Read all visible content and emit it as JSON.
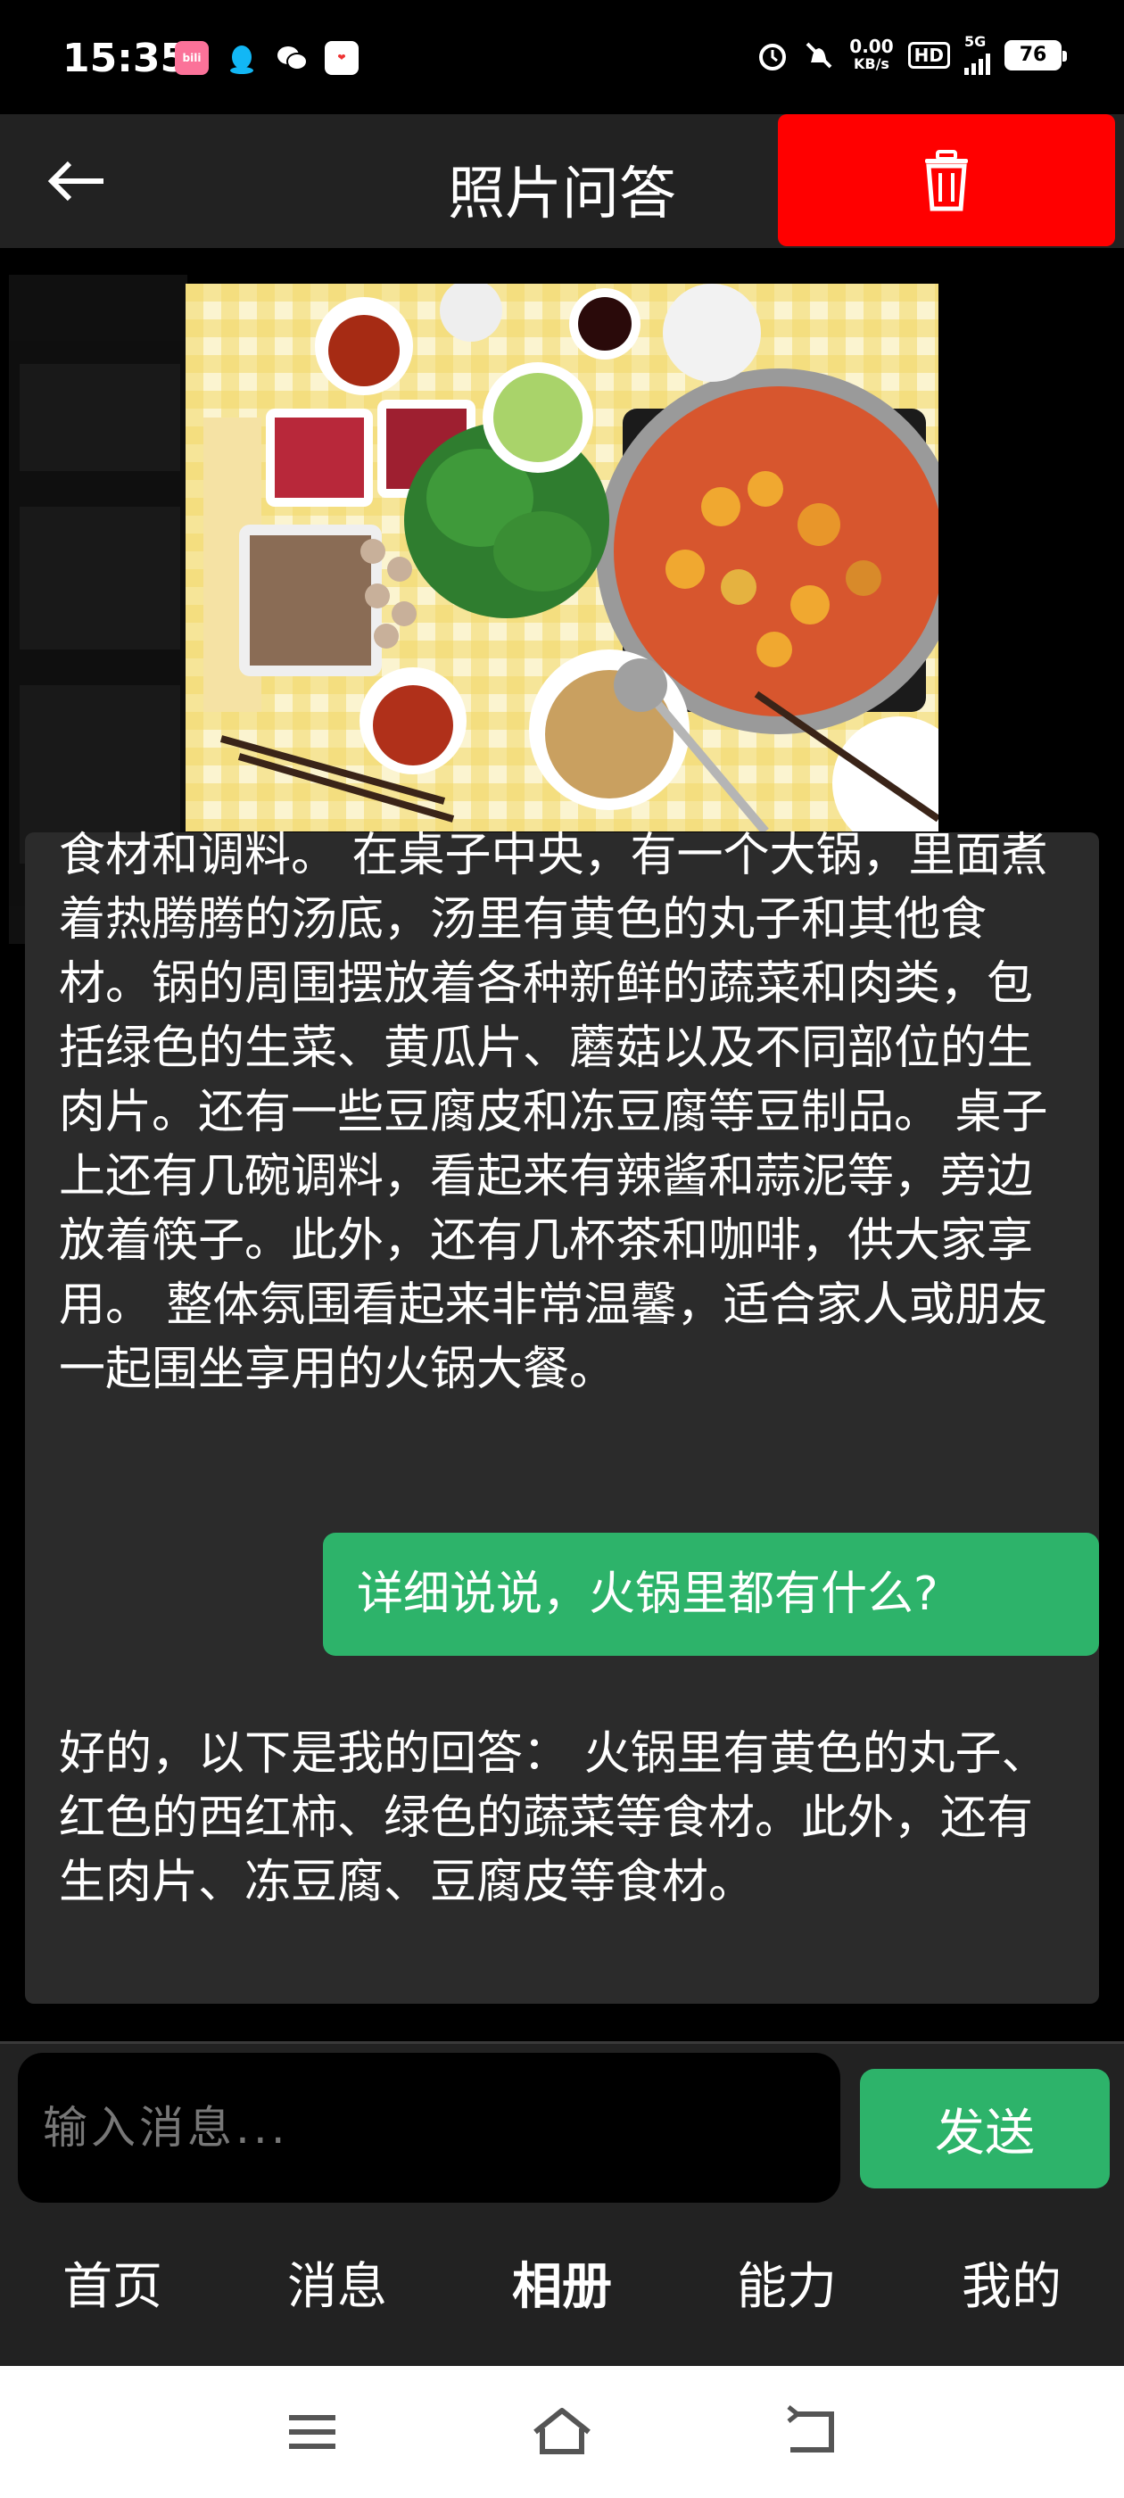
{
  "status_bar": {
    "time": "15:35",
    "apps": [
      {
        "name": "bilibili-icon",
        "label": "bilibili",
        "color": "#fb7299"
      },
      {
        "name": "qq-icon",
        "label": "",
        "color": "#12b7f5"
      },
      {
        "name": "wechat-icon",
        "label": "",
        "color": "#ffffff"
      },
      {
        "name": "app-icon",
        "label": "",
        "color": "#ffffff"
      }
    ],
    "net_speed_value": "0.00",
    "net_speed_unit": "KB/s",
    "hd": "HD",
    "network": "5G",
    "battery": "76"
  },
  "app_bar": {
    "title": "照片问答",
    "delete_color": "#ff0000"
  },
  "chat": {
    "ai_message_1": "食材和调料。 在桌子中央，有一个大锅，里面煮着热腾腾的汤底，汤里有黄色的丸子和其他食材。锅的周围摆放着各种新鲜的蔬菜和肉类，包括绿色的生菜、黄瓜片、蘑菇以及不同部位的生肉片。还有一些豆腐皮和冻豆腐等豆制品。 桌子上还有几碗调料，看起来有辣酱和蒜泥等，旁边放着筷子。此外，还有几杯茶和咖啡，供大家享用。 整体氛围看起来非常温馨，适合家人或朋友一起围坐享用的火锅大餐。",
    "user_message": "详细说说，火锅里都有什么?",
    "ai_message_2": "好的，以下是我的回答： 火锅里有黄色的丸子、红色的西红柿、绿色的蔬菜等食材。此外，还有生肉片、冻豆腐、豆腐皮等食材。"
  },
  "input": {
    "placeholder": "输入消息...",
    "value": "",
    "send_label": "发送",
    "send_color": "#2db36a"
  },
  "bottom_nav": {
    "items": [
      {
        "label": "首页",
        "active": false
      },
      {
        "label": "消息",
        "active": false
      },
      {
        "label": "相册",
        "active": true
      },
      {
        "label": "能力",
        "active": false
      },
      {
        "label": "我的",
        "active": false
      }
    ]
  }
}
